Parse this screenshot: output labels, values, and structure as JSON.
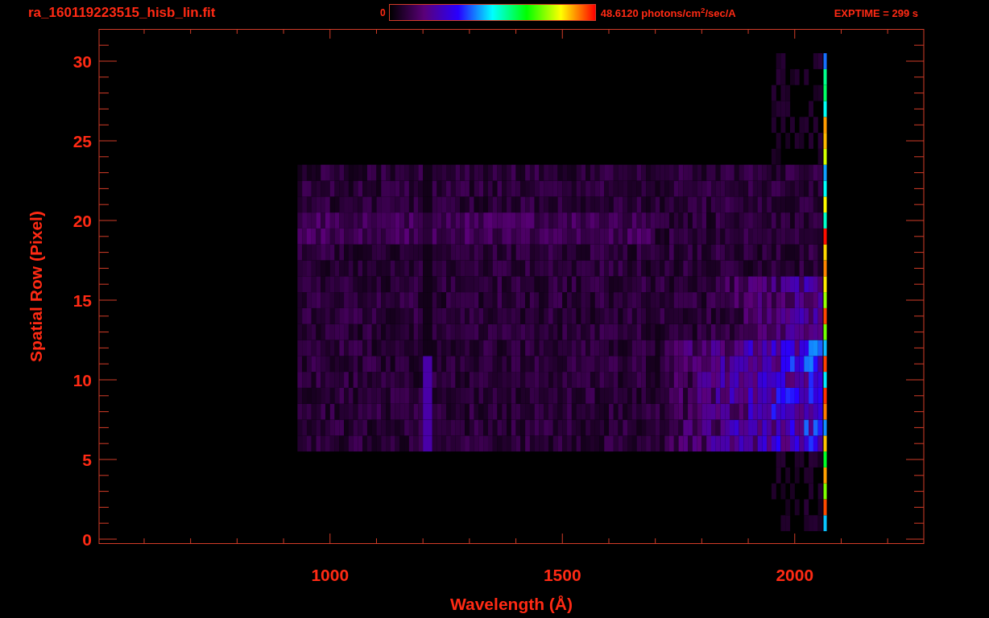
{
  "header": {
    "title": "ra_160119223515_hisb_lin.fit",
    "colorbar_min": "0",
    "colorbar_max": "48.6120 photons/cm$^{2}$/sec/A",
    "exposure": "EXPTIME = 299 s"
  },
  "plot": {
    "xlabel": "Wavelength (Å)",
    "ylabel": "Spatial Row (Pixel)",
    "xtick_labels": [
      "1000",
      "1500",
      "2000"
    ],
    "ytick_labels": [
      "30",
      "25",
      "20",
      "15",
      "10",
      "5",
      "0"
    ]
  }
}
